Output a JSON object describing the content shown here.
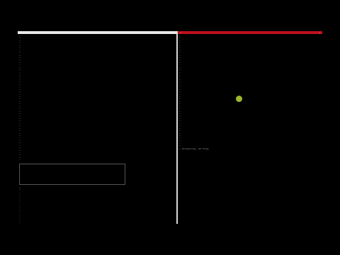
{
  "left_pane": {
    "top_lines": [
      "…",
      "…",
      "…",
      "…",
      "…",
      "…",
      "…",
      "…",
      "…",
      "…",
      "…",
      "…",
      "…",
      "…",
      "…",
      "…",
      "…",
      "…",
      "…",
      "…",
      "…",
      "…",
      "…",
      "…",
      "…",
      "…",
      "…",
      "…",
      "…",
      "…",
      "…",
      "…",
      "…",
      "…",
      "…",
      "…",
      "…",
      "…",
      "…",
      "…",
      "…",
      "…",
      "…",
      "…",
      "…",
      "…",
      "…",
      "…",
      "…",
      "…",
      "…",
      "…"
    ],
    "bottom_lines": [
      "…",
      "…",
      "…",
      "…",
      "…",
      "…",
      "…",
      "…",
      "…",
      "…",
      "…",
      "…",
      "…",
      "…",
      "…",
      "…",
      "…",
      "…",
      "…",
      "…",
      "…"
    ]
  },
  "right_pane": {
    "status_left": "…",
    "status_right": "…",
    "tree_lines": [
      "…",
      "…",
      "…",
      "…",
      "…",
      "…",
      "…",
      "…",
      "…",
      "…",
      "…",
      "…",
      "…",
      "…",
      "…",
      "…",
      "…",
      "…",
      "…",
      "…",
      "…",
      "…",
      "…",
      "…",
      "…",
      "…",
      "…",
      "…",
      "…",
      "…",
      "…",
      "…",
      "…",
      "…",
      "…",
      "…",
      "…",
      "…",
      "…",
      "…",
      "…",
      "…",
      "…",
      "…",
      "…",
      "…"
    ],
    "summary": "… directories, 23 files"
  },
  "colors": {
    "status_bar": "#c0101a",
    "cursor": "#9db92a"
  }
}
